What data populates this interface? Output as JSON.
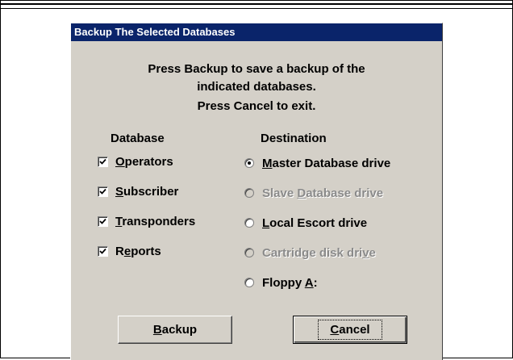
{
  "dialog": {
    "title": "Backup The Selected Databases",
    "message_line1": "Press Backup to save a backup of the",
    "message_line2": "indicated databases.",
    "message_line3": "Press Cancel to exit."
  },
  "database": {
    "header": "Database",
    "items": [
      {
        "pre": "",
        "u": "O",
        "post": "perators",
        "checked": true
      },
      {
        "pre": "",
        "u": "S",
        "post": "ubscriber",
        "checked": true
      },
      {
        "pre": "",
        "u": "T",
        "post": "ransponders",
        "checked": true
      },
      {
        "pre": "R",
        "u": "e",
        "post": "ports",
        "checked": true
      }
    ]
  },
  "destination": {
    "header": "Destination",
    "items": [
      {
        "pre": "",
        "u": "M",
        "post": "aster Database drive",
        "selected": true,
        "enabled": true
      },
      {
        "pre": "Slave ",
        "u": "D",
        "post": "atabase drive",
        "selected": false,
        "enabled": false
      },
      {
        "pre": "",
        "u": "L",
        "post": "ocal Escort drive",
        "selected": false,
        "enabled": true
      },
      {
        "pre": "Cartridge disk dri",
        "u": "v",
        "post": "e",
        "selected": false,
        "enabled": false
      },
      {
        "pre": "Floppy ",
        "u": "A",
        "post": ":",
        "selected": false,
        "enabled": true
      }
    ]
  },
  "buttons": {
    "backup": {
      "pre": "",
      "u": "B",
      "post": "ackup"
    },
    "cancel": {
      "pre": "",
      "u": "C",
      "post": "ancel"
    }
  }
}
